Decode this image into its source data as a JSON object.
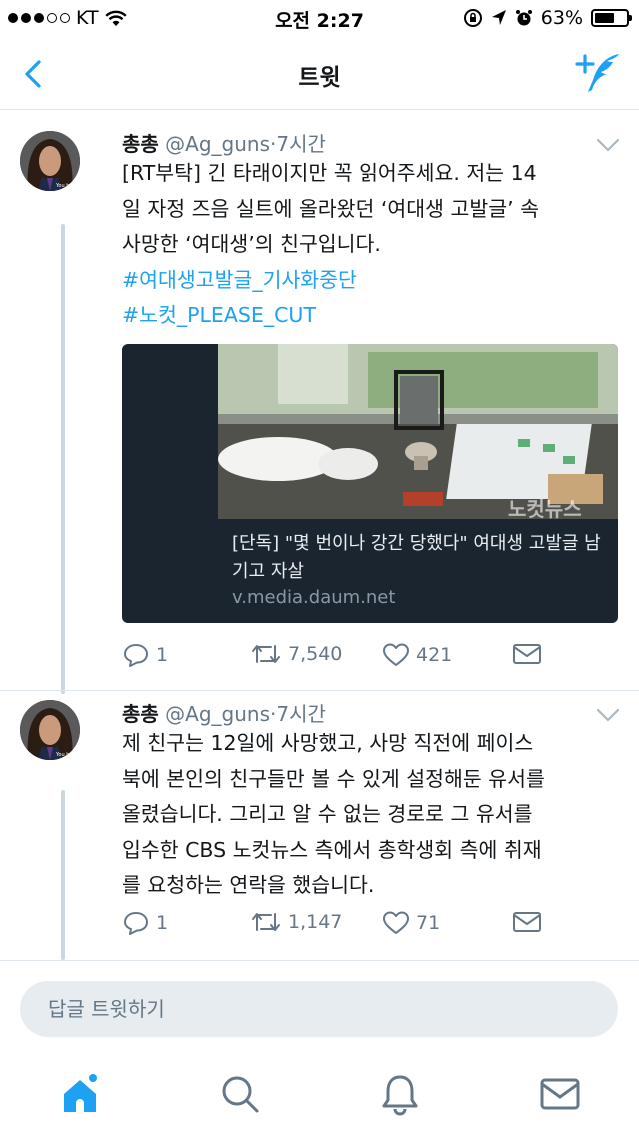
{
  "status_bar": {
    "carrier": "KT",
    "time": "오전 2:27",
    "battery": "63%",
    "battery_level": 0.63
  },
  "nav": {
    "title": "트윗",
    "back_icon": "chevron-left-icon",
    "compose_icon": "compose-tweet-icon"
  },
  "tweets": [
    {
      "name": "총총",
      "handle": "@Ag_guns",
      "separator": "·",
      "time": "7시간",
      "text_lines": [
        "[RT부탁] 긴 타래이지만 꼭 읽어주세요. 저는 14",
        "일 자정 즈음 실트에 올라왔던 ‘여대생 고발글’ 속",
        "사망한 ‘여대생’의 친구입니다."
      ],
      "hashtags": [
        "#여대생고발글_기사화중단",
        "#노컷_PLEASE_CUT"
      ],
      "card": {
        "title": "[단독] \"몇 번이나 강간 당했다\" 여대생 고발글 남기고 자살",
        "url": "v.media.daum.net",
        "image_watermark": "노컷뉴스"
      },
      "actions": {
        "replies": "1",
        "retweets": "7,540",
        "likes": "421"
      }
    },
    {
      "name": "총총",
      "handle": "@Ag_guns",
      "separator": "·",
      "time": "7시간",
      "text_lines": [
        "제 친구는 12일에 사망했고, 사망 직전에 페이스",
        "북에 본인의 친구들만 볼 수 있게 설정해둔 유서를",
        "올렸습니다. 그리고 알 수 없는 경로로 그 유서를",
        "입수한 CBS 노컷뉴스 측에서 총학생회 측에 취재",
        "를 요청하는 연락을 했습니다."
      ],
      "actions": {
        "replies": "1",
        "retweets": "1,147",
        "likes": "71"
      }
    }
  ],
  "reply": {
    "placeholder": "답글 트윗하기"
  },
  "tabbar": {
    "items": [
      "home-icon",
      "search-icon",
      "notifications-icon",
      "messages-icon"
    ]
  },
  "colors": {
    "accent": "#1da1f2",
    "text": "#14171a",
    "secondary": "#657786",
    "divider": "#e1e8ed"
  }
}
